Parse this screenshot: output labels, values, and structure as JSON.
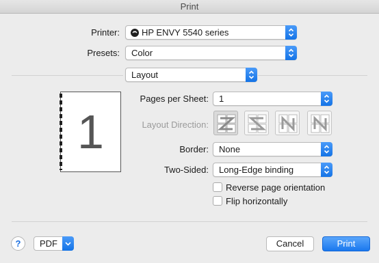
{
  "window": {
    "title": "Print"
  },
  "printer": {
    "label": "Printer:",
    "value": "HP ENVY 5540 series"
  },
  "presets": {
    "label": "Presets:",
    "value": "Color"
  },
  "section": {
    "value": "Layout"
  },
  "preview": {
    "page_number": "1"
  },
  "layout": {
    "pages_per_sheet": {
      "label": "Pages per Sheet:",
      "value": "1"
    },
    "direction": {
      "label": "Layout Direction:",
      "options": [
        "z-order-icon",
        "reverse-s-order-icon",
        "n-order-icon",
        "reverse-n-order-icon"
      ],
      "selected": 0
    },
    "border": {
      "label": "Border:",
      "value": "None"
    },
    "two_sided": {
      "label": "Two-Sided:",
      "value": "Long-Edge binding"
    },
    "reverse_orientation": {
      "label": "Reverse page orientation",
      "checked": false
    },
    "flip_horizontally": {
      "label": "Flip horizontally",
      "checked": false
    }
  },
  "footer": {
    "help": "?",
    "pdf": "PDF",
    "cancel": "Cancel",
    "print": "Print"
  },
  "colors": {
    "accent": "#1a78ee"
  }
}
